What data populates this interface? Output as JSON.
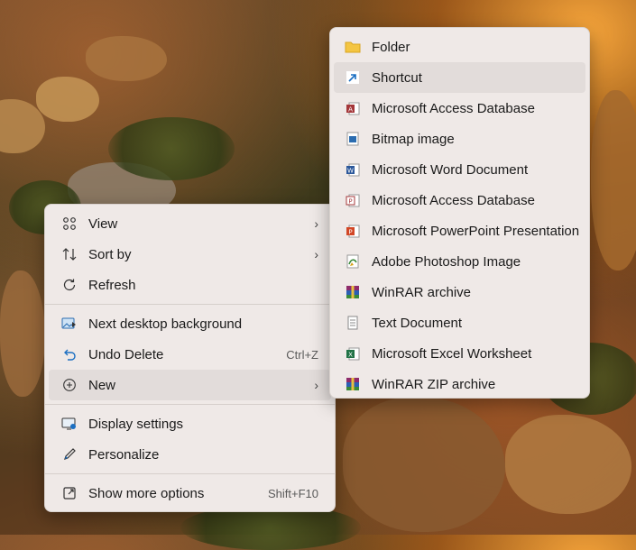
{
  "main_menu": {
    "items": [
      {
        "label": "View",
        "icon": "view-grid-icon"
      },
      {
        "label": "Sort by",
        "icon": "sort-icon"
      },
      {
        "label": "Refresh",
        "icon": "refresh-icon"
      },
      {
        "label": "Next desktop background",
        "icon": "next-background-icon"
      },
      {
        "label": "Undo Delete",
        "icon": "undo-icon",
        "shortcut": "Ctrl+Z"
      },
      {
        "label": "New",
        "icon": "new-plus-icon"
      },
      {
        "label": "Display settings",
        "icon": "display-settings-icon"
      },
      {
        "label": "Personalize",
        "icon": "personalize-pen-icon"
      },
      {
        "label": "Show more options",
        "icon": "show-more-options-icon",
        "shortcut": "Shift+F10"
      }
    ]
  },
  "new_submenu": {
    "items": [
      {
        "label": "Folder",
        "icon": "folder-icon"
      },
      {
        "label": "Shortcut",
        "icon": "shortcut-arrow-icon"
      },
      {
        "label": "Microsoft Access Database",
        "icon": "access-icon"
      },
      {
        "label": "Bitmap image",
        "icon": "bitmap-icon"
      },
      {
        "label": "Microsoft Word Document",
        "icon": "word-icon"
      },
      {
        "label": "Microsoft Access Database",
        "icon": "access-icon"
      },
      {
        "label": "Microsoft PowerPoint Presentation",
        "icon": "powerpoint-icon"
      },
      {
        "label": "Adobe Photoshop Image",
        "icon": "photoshop-icon"
      },
      {
        "label": "WinRAR archive",
        "icon": "winrar-icon"
      },
      {
        "label": "Text Document",
        "icon": "text-document-icon"
      },
      {
        "label": "Microsoft Excel Worksheet",
        "icon": "excel-icon"
      },
      {
        "label": "WinRAR ZIP archive",
        "icon": "winrar-zip-icon"
      }
    ]
  },
  "colors": {
    "menu_bg": "#efe9e7",
    "highlight": "#e2dcda",
    "accent": "#0067c0"
  }
}
